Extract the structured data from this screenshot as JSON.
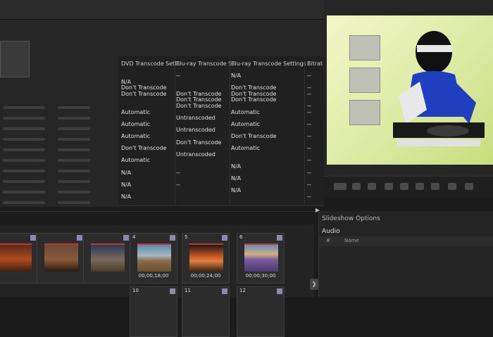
{
  "grid": {
    "headers": [
      "DVD Transcode Settings",
      "Blu-ray Transcode Sta...",
      "Blu-ray Transcode Settings",
      "Bitrat"
    ],
    "rows": [
      [
        "",
        "--",
        "N/A",
        "--"
      ],
      [
        "N/A",
        "",
        "",
        ""
      ],
      [
        "Don't Transcode",
        "",
        "Don't Transcode",
        "--"
      ],
      [
        "Don't Transcode",
        "Don't Transcode",
        "Don't Transcode",
        "--"
      ],
      [
        "",
        "Don't Transcode",
        "Don't Transcode",
        ""
      ],
      [
        "",
        "Don't Transcode",
        "",
        "--"
      ],
      [
        "Automatic",
        "",
        "Automatic",
        "--"
      ],
      [
        "",
        "Untranscoded",
        "",
        ""
      ],
      [
        "Automatic",
        "",
        "Automatic",
        "--"
      ],
      [
        "",
        "Untranscoded",
        "",
        ""
      ],
      [
        "Automatic",
        "",
        "Don't Transcode",
        "--"
      ],
      [
        "",
        "Don't Transcode",
        "",
        ""
      ],
      [
        "Don't Transcode",
        "",
        "Automatic",
        "--"
      ],
      [
        "",
        "Untranscoded",
        "",
        ""
      ],
      [
        "Automatic",
        "",
        "",
        "--"
      ],
      [
        "",
        "",
        "N/A",
        ""
      ],
      [
        "N/A",
        "--",
        "",
        "--"
      ],
      [
        "",
        "",
        "N/A",
        ""
      ],
      [
        "N/A",
        "--",
        "",
        "--"
      ],
      [
        "",
        "",
        "N/A",
        ""
      ],
      [
        "N/A",
        "",
        "",
        "--"
      ]
    ]
  },
  "slideshow": {
    "title": "Slideshow Options",
    "audio_label": "Audio",
    "hash_col": "#",
    "name_col": "Name"
  },
  "tiles": [
    {
      "num": "",
      "time": ""
    },
    {
      "num": "",
      "time": ""
    },
    {
      "num": "",
      "time": ""
    },
    {
      "num": "4",
      "time": "00;00;18;00"
    },
    {
      "num": "5",
      "time": "00;00;24;00"
    },
    {
      "num": "6",
      "time": "00;00;30;00"
    }
  ],
  "tiles_row2": [
    "10",
    "11",
    "12"
  ],
  "scroll_arrow": "▶",
  "panel_arrow": "❯",
  "colors": {
    "panel_bg": "#262626",
    "grid_bg": "#202020",
    "preview_bg": "#dbe9a0",
    "accent_red": "#c0392b"
  }
}
